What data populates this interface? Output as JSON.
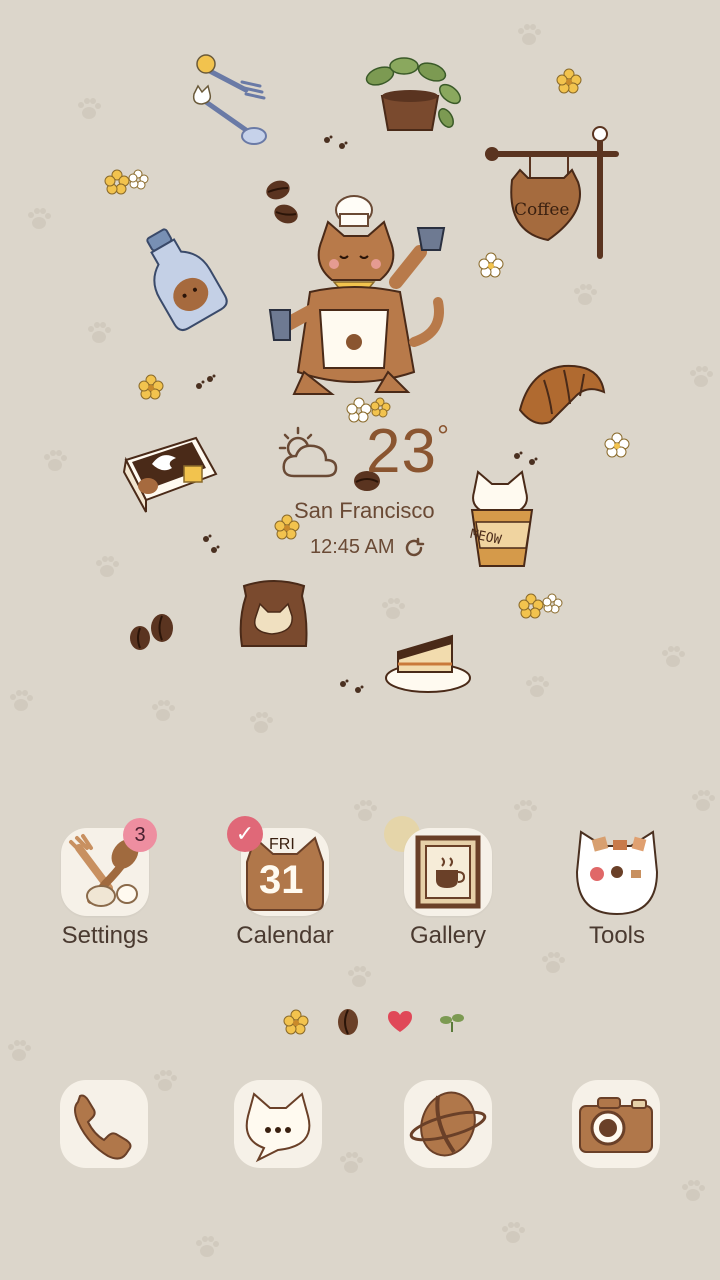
{
  "weather": {
    "temperature": "23",
    "degree_symbol": "°",
    "city": "San Francisco",
    "time": "12:45 AM",
    "condition_icon": "sun-cloud-icon"
  },
  "apps": [
    {
      "label": "Settings",
      "badge": "3",
      "icon": "spoon-fork-icon"
    },
    {
      "label": "Calendar",
      "day": "FRI",
      "date": "31",
      "icon": "calendar-cat-icon"
    },
    {
      "label": "Gallery",
      "icon": "framed-coffee-icon"
    },
    {
      "label": "Tools",
      "icon": "cat-folder-icon"
    }
  ],
  "page_indicator": [
    "flower",
    "coffee-bean",
    "heart",
    "sprout"
  ],
  "dock": [
    {
      "icon": "phone-icon"
    },
    {
      "icon": "message-cat-icon"
    },
    {
      "icon": "coffee-bean-browser-icon"
    },
    {
      "icon": "camera-icon"
    }
  ],
  "decor": {
    "coffee_sign": "Coffee",
    "cup_text": "MEOW"
  },
  "colors": {
    "background": "#dcd6cb",
    "brown": "#8a5530",
    "tile": "#f6f1e8",
    "badge": "#ee8ea0"
  }
}
